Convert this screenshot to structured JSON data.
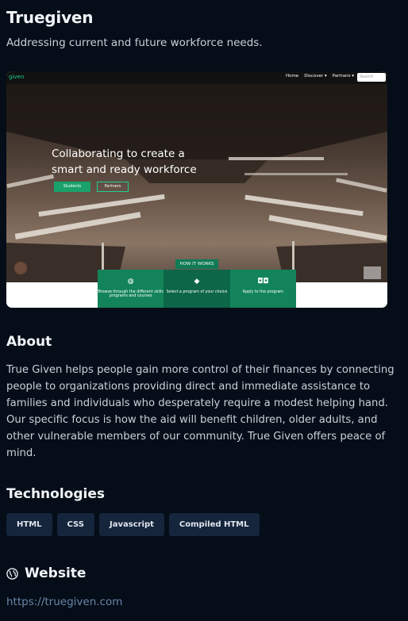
{
  "project": {
    "title": "Truegiven",
    "subtitle": "Addressing current and future workforce needs."
  },
  "screenshot": {
    "logo": "given",
    "nav": [
      "Home",
      "Discover ▾",
      "Partners ▾"
    ],
    "search_placeholder": "Search",
    "hero_heading": "Collaborating to create a smart and ready workforce",
    "btn_primary": "Students",
    "btn_secondary": "Partners",
    "how_tab": "HOW IT WORKS",
    "cards": [
      {
        "icon": "globe-icon",
        "text": "Browse through the different skills programs and courses"
      },
      {
        "icon": "cube-icon",
        "text": "Select a program of your choice"
      },
      {
        "icon": "glasses-icon",
        "text": "Apply to the program"
      }
    ]
  },
  "about": {
    "heading": "About",
    "text": "True Given helps people gain more control of their finances by connecting people to organizations providing direct and immediate assistance to families and individuals who desperately require a modest helping hand. Our specific focus is how the aid will benefit children, older adults, and other vulnerable members of our community. True Given offers peace of mind."
  },
  "technologies": {
    "heading": "Technologies",
    "tags": [
      "HTML",
      "CSS",
      "Javascript",
      "Compiled HTML"
    ]
  },
  "website": {
    "heading": "Website",
    "url": "https://truegiven.com"
  },
  "colors": {
    "background": "#040d18",
    "tag_bg": "#15253c",
    "link": "#6a86a8",
    "accent_green": "#13845a"
  }
}
